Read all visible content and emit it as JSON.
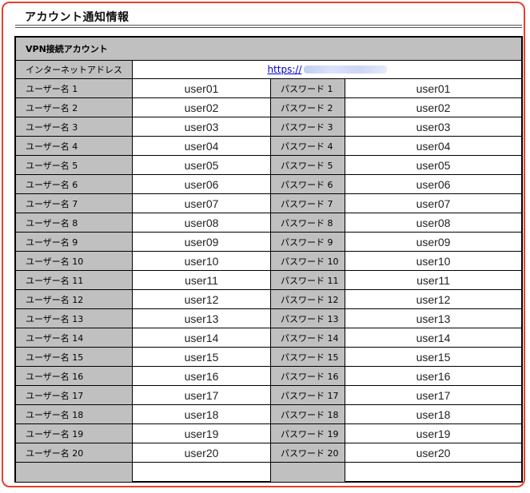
{
  "page": {
    "title": "アカウント通知情報"
  },
  "table": {
    "header": "VPN接続アカウント",
    "url_label": "インターネットアドレス",
    "url_value": "https://",
    "rows": [
      {
        "user_label": "ユーザー名 1",
        "user_value": "user01",
        "pass_label": "パスワード 1",
        "pass_value": "user01"
      },
      {
        "user_label": "ユーザー名 2",
        "user_value": "user02",
        "pass_label": "パスワード 2",
        "pass_value": "user02"
      },
      {
        "user_label": "ユーザー名 3",
        "user_value": "user03",
        "pass_label": "パスワード 3",
        "pass_value": "user03"
      },
      {
        "user_label": "ユーザー名 4",
        "user_value": "user04",
        "pass_label": "パスワード 4",
        "pass_value": "user04"
      },
      {
        "user_label": "ユーザー名 5",
        "user_value": "user05",
        "pass_label": "パスワード 5",
        "pass_value": "user05"
      },
      {
        "user_label": "ユーザー名 6",
        "user_value": "user06",
        "pass_label": "パスワード 6",
        "pass_value": "user06"
      },
      {
        "user_label": "ユーザー名 7",
        "user_value": "user07",
        "pass_label": "パスワード 7",
        "pass_value": "user07"
      },
      {
        "user_label": "ユーザー名 8",
        "user_value": "user08",
        "pass_label": "パスワード 8",
        "pass_value": "user08"
      },
      {
        "user_label": "ユーザー名 9",
        "user_value": "user09",
        "pass_label": "パスワード 9",
        "pass_value": "user09"
      },
      {
        "user_label": "ユーザー名 10",
        "user_value": "user10",
        "pass_label": "パスワード 10",
        "pass_value": "user10"
      },
      {
        "user_label": "ユーザー名 11",
        "user_value": "user11",
        "pass_label": "パスワード 11",
        "pass_value": "user11"
      },
      {
        "user_label": "ユーザー名 12",
        "user_value": "user12",
        "pass_label": "パスワード 12",
        "pass_value": "user12"
      },
      {
        "user_label": "ユーザー名 13",
        "user_value": "user13",
        "pass_label": "パスワード 13",
        "pass_value": "user13"
      },
      {
        "user_label": "ユーザー名 14",
        "user_value": "user14",
        "pass_label": "パスワード 14",
        "pass_value": "user14"
      },
      {
        "user_label": "ユーザー名 15",
        "user_value": "user15",
        "pass_label": "パスワード 15",
        "pass_value": "user15"
      },
      {
        "user_label": "ユーザー名 16",
        "user_value": "user16",
        "pass_label": "パスワード 16",
        "pass_value": "user16"
      },
      {
        "user_label": "ユーザー名 17",
        "user_value": "user17",
        "pass_label": "パスワード 17",
        "pass_value": "user17"
      },
      {
        "user_label": "ユーザー名 18",
        "user_value": "user18",
        "pass_label": "パスワード 18",
        "pass_value": "user18"
      },
      {
        "user_label": "ユーザー名 19",
        "user_value": "user19",
        "pass_label": "パスワード 19",
        "pass_value": "user19"
      },
      {
        "user_label": "ユーザー名 20",
        "user_value": "user20",
        "pass_label": "パスワード 20",
        "pass_value": "user20"
      }
    ]
  }
}
